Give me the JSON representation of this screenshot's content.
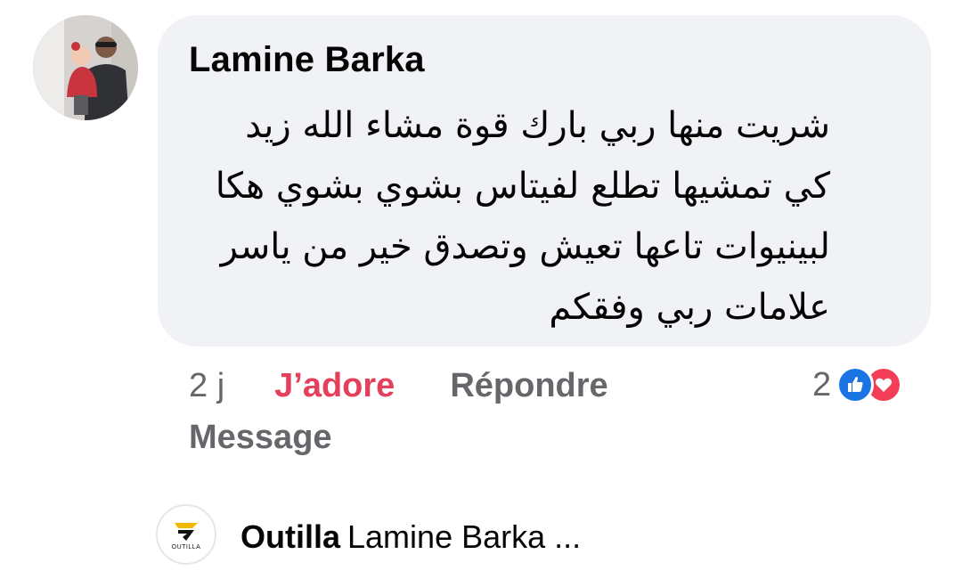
{
  "comment": {
    "author": "Lamine Barka",
    "text": "شريت منها ربي بارك قوة مشاء الله زيد كي تمشيها تطلع لفيتاس بشوي بشوي هكا لبينيوات تاعها تعيش وتصدق خير من ياسر علامات ربي وفقكم",
    "avatar_icon": "profile-photo"
  },
  "actions": {
    "time": "2 j",
    "reaction_label": "J’adore",
    "reply_label": "Répondre",
    "message_label": "Message"
  },
  "reactions": {
    "count": "2",
    "icons": [
      "like-icon",
      "love-icon"
    ],
    "colors": {
      "like": "#1b74e4",
      "love": "#f33e58"
    }
  },
  "reply_preview": {
    "author": "Outilla",
    "snippet": "Lamine Barka ...",
    "brand_text": "OUTILLA",
    "avatar_icon": "outilla-logo"
  },
  "colors": {
    "bubble": "#f0f2f5",
    "active_reaction": "#e4405b",
    "secondary_text": "#65676b"
  }
}
